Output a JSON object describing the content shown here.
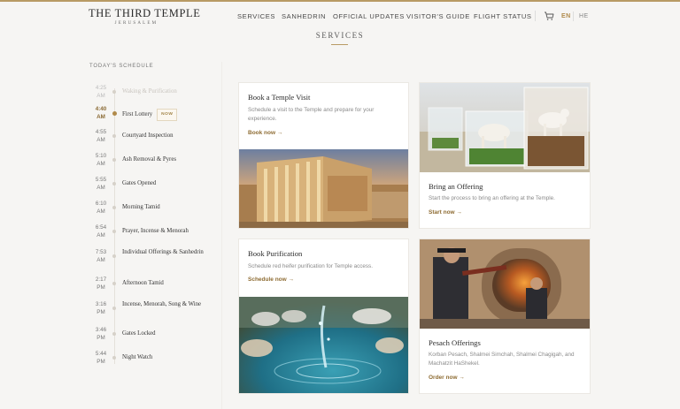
{
  "header": {
    "logo_title": "THE THIRD TEMPLE",
    "logo_subtitle": "JERUSALEM",
    "nav": [
      "SERVICES",
      "SANHEDRIN",
      "OFFICIAL UPDATES",
      "VISITOR'S GUIDE",
      "FLIGHT STATUS"
    ],
    "lang_active": "EN",
    "lang_other": "HE",
    "cart_icon": "cart-icon"
  },
  "page_title": "SERVICES",
  "schedule": {
    "label": "TODAY'S SCHEDULE",
    "now_badge": "NOW",
    "items": [
      {
        "time": "4:25",
        "ampm": "AM",
        "name": "Waking & Purification",
        "state": "past"
      },
      {
        "time": "4:40",
        "ampm": "AM",
        "name": "First Lottery",
        "state": "active"
      },
      {
        "time": "4:55",
        "ampm": "AM",
        "name": "Courtyard Inspection",
        "state": "upcoming"
      },
      {
        "time": "5:10",
        "ampm": "AM",
        "name": "Ash Removal & Pyres",
        "state": "upcoming"
      },
      {
        "time": "5:55",
        "ampm": "AM",
        "name": "Gates Opened",
        "state": "upcoming"
      },
      {
        "time": "6:10",
        "ampm": "AM",
        "name": "Morning Tamid",
        "state": "upcoming"
      },
      {
        "time": "6:54",
        "ampm": "AM",
        "name": "Prayer, Incense & Menorah",
        "state": "upcoming"
      },
      {
        "time": "7:53",
        "ampm": "AM",
        "name": "Individual Offerings & Sanhedrin",
        "state": "upcoming"
      },
      {
        "time": "2:17",
        "ampm": "PM",
        "name": "Afternoon Tamid",
        "state": "upcoming"
      },
      {
        "time": "3:16",
        "ampm": "PM",
        "name": "Incense, Menorah, Song & Wine",
        "state": "upcoming"
      },
      {
        "time": "3:46",
        "ampm": "PM",
        "name": "Gates Locked",
        "state": "upcoming"
      },
      {
        "time": "5:44",
        "ampm": "PM",
        "name": "Night Watch",
        "state": "upcoming"
      }
    ]
  },
  "cards": {
    "visit": {
      "title": "Book a Temple Visit",
      "desc": "Schedule a visit to the Temple and prepare for your experience.",
      "link": "Book now →"
    },
    "offering": {
      "title": "Bring an Offering",
      "desc": "Start the process to bring an offering at the Temple.",
      "link": "Start now →"
    },
    "purification": {
      "title": "Book Purification",
      "desc": "Schedule red heifer purification for Temple access.",
      "link": "Schedule now →"
    },
    "pesach": {
      "title": "Pesach Offerings",
      "desc": "Korban Pesach, Shalmei Simchah, Shalmei Chagigah, and Machatzit HaShekel.",
      "link": "Order now →"
    }
  },
  "colors": {
    "accent": "#b08a4a",
    "link": "#8e6c33",
    "background": "#f6f5f3"
  }
}
